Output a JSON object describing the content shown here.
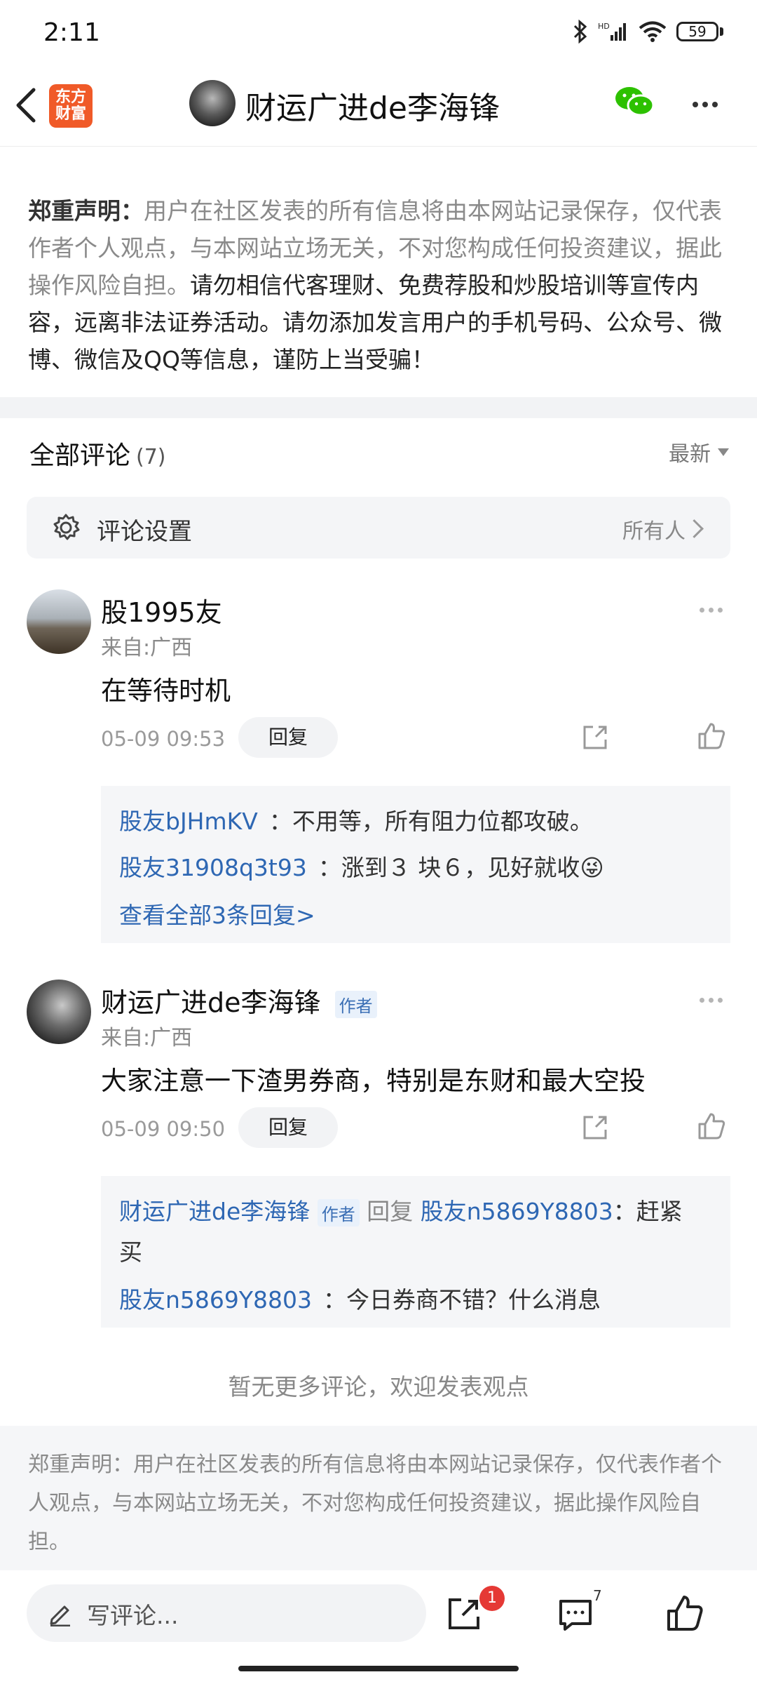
{
  "status": {
    "time": "2:11",
    "battery": "59"
  },
  "header": {
    "logo_line1": "东方",
    "logo_line2": "财富",
    "title": "财运广进de李海锋"
  },
  "disclaimer": {
    "label": "郑重声明：",
    "body": "用户在社区发表的所有信息将由本网站记录保存，仅代表作者个人观点，与本网站立场无关，不对您构成任何投资建议，据此操作风险自担。",
    "warning": "请勿相信代客理财、免费荐股和炒股培训等宣传内容，远离非法证券活动。请勿添加发言用户的手机号码、公众号、微博、微信及QQ等信息，谨防上当受骗！"
  },
  "comments_header": {
    "title": "全部评论",
    "count": "(7)",
    "sort": "最新"
  },
  "settings": {
    "label": "评论设置",
    "value": "所有人"
  },
  "comments": [
    {
      "user": "股1995友",
      "location": "来自:广西",
      "text": "在等待时机",
      "time": "05-09 09:53",
      "reply_label": "回复",
      "replies": [
        {
          "user": "股友bJHmKV",
          "text": "：不用等，所有阻力位都攻破。"
        },
        {
          "user": "股友31908q3t93",
          "text": "：涨到３ 块６，见好就收😜"
        }
      ],
      "view_all": "查看全部3条回复>"
    },
    {
      "user": "财运广进de李海锋",
      "badge": "作者",
      "location": "来自:广西",
      "text": "大家注意一下渣男券商，特别是东财和最大空投",
      "time": "05-09 09:50",
      "reply_label": "回复",
      "replies": [
        {
          "user": "财运广进de李海锋",
          "badge": "作者",
          "verb": "回复",
          "target": "股友n5869Y8803",
          "text": "：赶紧",
          "text2": "买"
        },
        {
          "user": "股友n5869Y8803",
          "text": "：今日券商不错？什么消息"
        }
      ]
    }
  ],
  "no_more": "暂无更多评论，欢迎发表观点",
  "bottom_disclaimer": "郑重声明：用户在社区发表的所有信息将由本网站记录保存，仅代表作者个人观点，与本网站立场无关，不对您构成任何投资建议，据此操作风险自担。",
  "bottom_bar": {
    "input_placeholder": "写评论...",
    "share_badge": "1",
    "comment_count": "7"
  },
  "colors": {
    "accent_blue": "#2e67b3",
    "logo_orange": "#f05a28",
    "badge_red": "#e53935",
    "wechat_green": "#2dc100"
  }
}
